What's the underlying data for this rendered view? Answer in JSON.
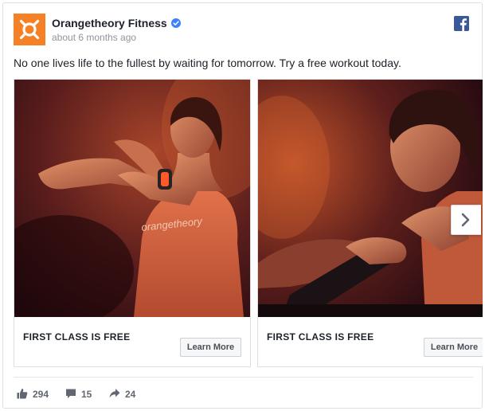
{
  "post": {
    "page_name": "Orangetheory Fitness",
    "timestamp": "about 6 months ago",
    "text": "No one lives life to the fullest by waiting for tomorrow. Try a free workout today.",
    "brand_color": "#f58025",
    "avatar_icon": "orangetheory-logo-icon",
    "verified_icon": "verified-badge-icon",
    "platform_icon": "facebook-logo-icon"
  },
  "carousel": {
    "cards": [
      {
        "title": "FIRST CLASS IS FREE",
        "cta": "Learn More",
        "image": "woman-stretching-arm-photo"
      },
      {
        "title": "FIRST CLASS IS FREE",
        "cta": "Learn More",
        "image": "woman-on-rowing-machine-photo"
      }
    ],
    "next_icon": "chevron-right-icon"
  },
  "stats": {
    "likes": "294",
    "comments": "15",
    "shares": "24"
  }
}
